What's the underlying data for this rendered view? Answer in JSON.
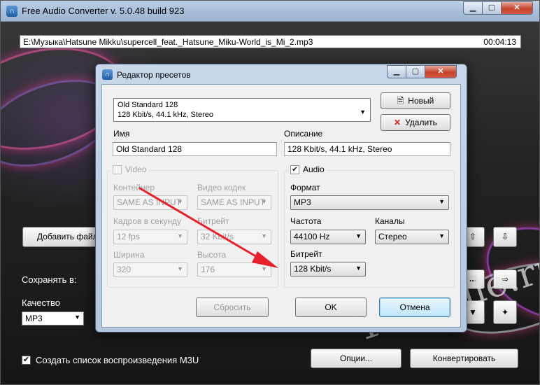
{
  "main_window": {
    "title": "Free Audio Converter  v. 5.0.48 build 923",
    "window_buttons": {
      "minimize": "▁",
      "maximize": "▢",
      "close": "✕"
    },
    "file_path": "E:\\Музыка\\Hatsune Mikku\\supercell_feat._Hatsune_Miku-World_is_Mi_2.mp3",
    "file_duration": "00:04:13",
    "add_files_label": "Добавить файл",
    "move_up_icon": "⇧",
    "move_down_icon": "⇩",
    "save_to_label": "Сохранять в:",
    "browse_label": "...",
    "open_folder_icon": "⇨",
    "quality_label": "Качество",
    "quality_value": "MP3",
    "quality_menu_icon": "▼",
    "wizard_icon": "✦",
    "m3u_label": "Создать список воспроизведения M3U",
    "m3u_checked": "✔",
    "options_label": "Опции...",
    "convert_label": "Конвертировать",
    "watermark": "1001file.ru",
    "logo_icon": "∩"
  },
  "dialog": {
    "title": "Редактор пресетов",
    "window_buttons": {
      "minimize": "▁",
      "maximize": "▢",
      "close": "✕"
    },
    "preset": {
      "name": "Old Standard 128",
      "details": "128 Kbit/s, 44.1 kHz, Stereo"
    },
    "new_button": "Новый",
    "new_icon": "🗎",
    "delete_button": "Удалить",
    "delete_icon": "✕",
    "name_label": "Имя",
    "name_value": "Old Standard 128",
    "description_label": "Описание",
    "description_value": "128 Kbit/s, 44.1 kHz, Stereo",
    "video": {
      "checkbox_label": "Video",
      "container_label": "Контейнер",
      "container_value": "SAME AS INPUT",
      "codec_label": "Видео кодек",
      "codec_value": "SAME AS INPUT",
      "fps_label": "Кадров в секунду",
      "fps_value": "12 fps",
      "bitrate_label": "Битрейт",
      "bitrate_value": "32 Kbit/s",
      "width_label": "Ширина",
      "width_value": "320",
      "height_label": "Высота",
      "height_value": "176"
    },
    "audio": {
      "checkbox_label": "Audio",
      "checked": "✔",
      "format_label": "Формат",
      "format_value": "MP3",
      "frequency_label": "Частота",
      "frequency_value": "44100 Hz",
      "channels_label": "Каналы",
      "channels_value": "Стерео",
      "bitrate_label": "Битрейт",
      "bitrate_value": "128 Kbit/s"
    },
    "reset_button": "Сбросить",
    "ok_button": "OK",
    "cancel_button": "Отмена"
  },
  "colors": {
    "annotation_arrow": "#e8202a",
    "titlebar": "#a9c0db",
    "dialog_body": "#f0f0f0"
  }
}
